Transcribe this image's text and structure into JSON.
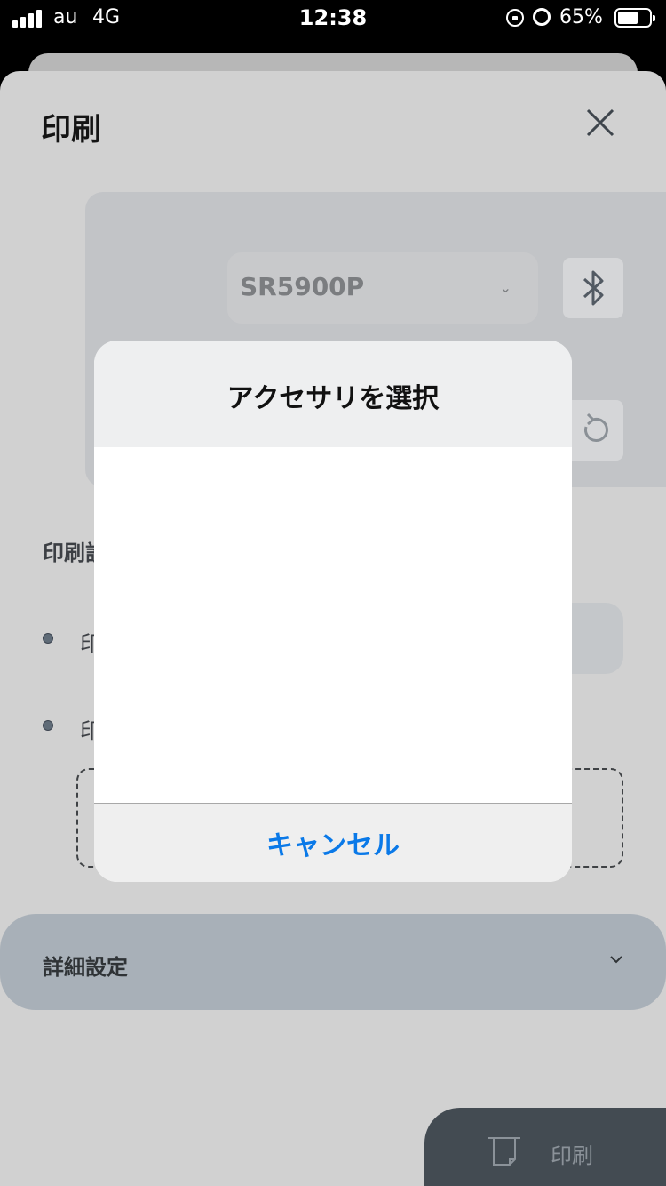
{
  "status_bar": {
    "carrier": "au",
    "network": "4G",
    "time": "12:38",
    "battery_percent": "65%",
    "battery_level": 0.65
  },
  "sheet": {
    "title": "印刷",
    "printer": {
      "selected": "SR5900P"
    },
    "section_label": "印刷設",
    "bullets": [
      "印",
      "印"
    ],
    "details_label": "詳細設定",
    "print_button_label": "印刷"
  },
  "dialog": {
    "title": "アクセサリを選択",
    "cancel_label": "キャンセル"
  },
  "colors": {
    "accent": "#0A79E8",
    "sheet_bg": "#D1D1D1",
    "details_bar": "#A8B0B8",
    "print_button": "#434B52"
  }
}
